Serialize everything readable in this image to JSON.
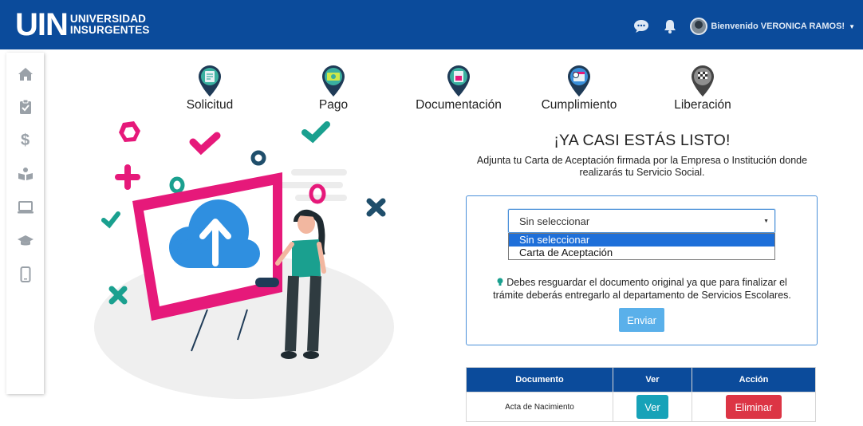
{
  "header": {
    "logo_short": "UIN",
    "logo_line1": "UNIVERSIDAD",
    "logo_line2": "INSURGENTES",
    "welcome": "Bienvenido VERONICA RAMOS!",
    "icons": [
      "chat-icon",
      "bell-icon",
      "avatar"
    ]
  },
  "sidebar": {
    "items": [
      {
        "icon": "home-icon"
      },
      {
        "icon": "clipboard-check-icon"
      },
      {
        "icon": "dollar-icon"
      },
      {
        "icon": "reader-icon"
      },
      {
        "icon": "laptop-icon"
      },
      {
        "icon": "graduation-cap-icon"
      },
      {
        "icon": "mobile-icon"
      }
    ]
  },
  "steps": [
    {
      "label": "Solicitud",
      "color": "#3ab0a0"
    },
    {
      "label": "Pago",
      "color": "#3ab0a0"
    },
    {
      "label": "Documentación",
      "color": "#3ab0a0"
    },
    {
      "label": "Cumplimiento",
      "color": "#3a8fd9"
    },
    {
      "label": "Liberación",
      "color": "#6b6b6b"
    }
  ],
  "main": {
    "title": "¡YA CASI ESTÁS LISTO!",
    "subtitle_line1": "Adjunta tu Carta de Aceptación firmada por la Empresa o Institución donde",
    "subtitle_line2": "realizarás tu Servicio Social.",
    "select_value": "Sin seleccionar",
    "options": [
      "Sin seleccionar",
      "Carta de Aceptación"
    ],
    "note_line1": "Debes resguardar el documento original ya que para finalizar el",
    "note_line2": "trámite deberás entregarlo al departamento de Servicios Escolares.",
    "send_label": "Enviar"
  },
  "table": {
    "headers": [
      "Documento",
      "Ver",
      "Acción"
    ],
    "rows": [
      {
        "documento": "Acta de Nacimiento",
        "ver": "Ver",
        "accion": "Eliminar"
      }
    ]
  },
  "colors": {
    "header_bg": "#0b4b9b",
    "accent_pink": "#e6197a",
    "accent_teal": "#1aa08f",
    "cloud_blue": "#2f8fe0",
    "send_button": "#5ab0ea",
    "ver_button": "#17a2b8",
    "eliminar_button": "#dc3545"
  }
}
